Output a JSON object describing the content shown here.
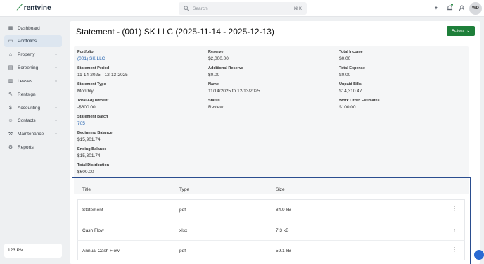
{
  "brand": {
    "name": "rentvine",
    "mark": "⟋"
  },
  "search": {
    "placeholder": "Search",
    "shortcut": "⌘ K"
  },
  "user": {
    "initials": "WD"
  },
  "sidebar": {
    "items": [
      {
        "label": "Dashboard",
        "icon": "dashboard-icon",
        "glyph": "▦",
        "chevron": false,
        "active": false
      },
      {
        "label": "Portfolios",
        "icon": "portfolios-icon",
        "glyph": "▭",
        "chevron": false,
        "active": true
      },
      {
        "label": "Property",
        "icon": "property-icon",
        "glyph": "⌂",
        "chevron": true,
        "active": false
      },
      {
        "label": "Screening",
        "icon": "screening-icon",
        "glyph": "▤",
        "chevron": true,
        "active": false
      },
      {
        "label": "Leases",
        "icon": "leases-icon",
        "glyph": "▥",
        "chevron": true,
        "active": false
      },
      {
        "label": "Rentsign",
        "icon": "rentsign-icon",
        "glyph": "✎",
        "chevron": false,
        "active": false
      },
      {
        "label": "Accounting",
        "icon": "accounting-icon",
        "glyph": "$",
        "chevron": true,
        "active": false
      },
      {
        "label": "Contacts",
        "icon": "contacts-icon",
        "glyph": "☺",
        "chevron": true,
        "active": false
      },
      {
        "label": "Maintenance",
        "icon": "maintenance-icon",
        "glyph": "⚒",
        "chevron": true,
        "active": false
      },
      {
        "label": "Reports",
        "icon": "reports-icon",
        "glyph": "⚙",
        "chevron": false,
        "active": false
      }
    ],
    "time": "123 PM"
  },
  "page": {
    "title": "Statement - (001) SK LLC (2025-11-14 - 2025-12-13)",
    "actions_label": "Actions"
  },
  "details": {
    "col1": [
      {
        "label": "Portfolio",
        "value": "(001) SK LLC",
        "link": true
      },
      {
        "label": "Statement Period",
        "value": "11-14-2025 - 12-13-2025",
        "link": false
      },
      {
        "label": "Statement Type",
        "value": "Monthly",
        "link": false
      },
      {
        "label": "Total Adjustment",
        "value": "-$600.00",
        "link": false
      },
      {
        "label": "Statement Batch",
        "value": "705",
        "link": true
      },
      {
        "label": "Beginning Balance",
        "value": "$15,901.74",
        "link": false
      },
      {
        "label": "Ending Balance",
        "value": "$15,301.74",
        "link": false
      },
      {
        "label": "Total Distribution",
        "value": "$600.00",
        "link": false
      }
    ],
    "col2": [
      {
        "label": "Reserve",
        "value": "$2,000.00",
        "link": false
      },
      {
        "label": "Additional Reserve",
        "value": "$0.00",
        "link": false
      },
      {
        "label": "Name",
        "value": "11/14/2025 to 12/13/2025",
        "link": false
      },
      {
        "label": "Status",
        "value": "Review",
        "link": false
      }
    ],
    "col3": [
      {
        "label": "Total Income",
        "value": "$0.00",
        "link": false
      },
      {
        "label": "Total Expense",
        "value": "$0.00",
        "link": false
      },
      {
        "label": "Unpaid Bills",
        "value": "$14,310.47",
        "link": false
      },
      {
        "label": "Work Order Estimates",
        "value": "$100.00",
        "link": false
      }
    ]
  },
  "documents": {
    "headers": {
      "title": "Title",
      "type": "Type",
      "size": "Size"
    },
    "rows": [
      {
        "title": "Statement",
        "type": "pdf",
        "size": "84.9 kB"
      },
      {
        "title": "Cash Flow",
        "type": "xlsx",
        "size": "7.3 kB"
      },
      {
        "title": "Annual Cash Flow",
        "type": "pdf",
        "size": "59.1 kB"
      }
    ]
  },
  "colors": {
    "brand": "#2e8b4a",
    "action": "#1e7f3a",
    "link": "#2a67b1",
    "highlight_border": "#2a4d8f"
  }
}
